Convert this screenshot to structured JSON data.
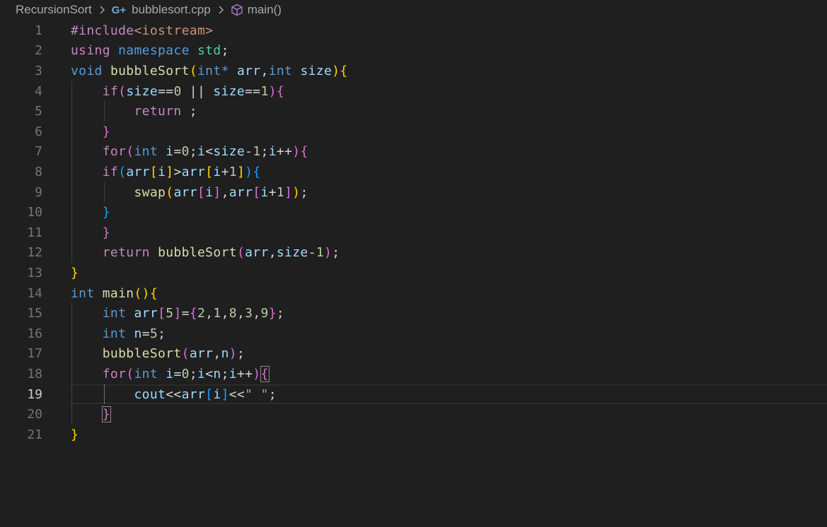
{
  "breadcrumb": {
    "folder": "RecursionSort",
    "file": "bubblesort.cpp",
    "file_icon": "C++ file icon",
    "symbol": "main()",
    "symbol_icon": "cube-icon"
  },
  "editor": {
    "current_line": 19,
    "lines": [
      {
        "n": "1",
        "tokens": [
          [
            "#include",
            "kw-c"
          ],
          [
            "<iostream>",
            "str"
          ]
        ]
      },
      {
        "n": "2",
        "tokens": [
          [
            "using",
            "kw-c"
          ],
          [
            " ",
            "p"
          ],
          [
            "namespace",
            "kw-b"
          ],
          [
            " ",
            "p"
          ],
          [
            "std",
            "ns"
          ],
          [
            ";",
            "p"
          ]
        ]
      },
      {
        "n": "3",
        "tokens": [
          [
            "void",
            "kw-b"
          ],
          [
            " ",
            "p"
          ],
          [
            "bubbleSort",
            "fn"
          ],
          [
            "(",
            "b1"
          ],
          [
            "int",
            "kw-b"
          ],
          [
            "*",
            "kw-b"
          ],
          [
            " ",
            "p"
          ],
          [
            "arr",
            "var"
          ],
          [
            ",",
            "p"
          ],
          [
            "int",
            "kw-b"
          ],
          [
            " ",
            "p"
          ],
          [
            "size",
            "var"
          ],
          [
            ")",
            "b1"
          ],
          [
            "{",
            "b1"
          ]
        ]
      },
      {
        "n": "4",
        "tokens": [
          [
            "    ",
            "p"
          ],
          [
            "if",
            "kw-c"
          ],
          [
            "(",
            "b2"
          ],
          [
            "size",
            "var"
          ],
          [
            "==",
            "p"
          ],
          [
            "0",
            "num"
          ],
          [
            " || ",
            "p"
          ],
          [
            "size",
            "var"
          ],
          [
            "==",
            "p"
          ],
          [
            "1",
            "num"
          ],
          [
            ")",
            "b2"
          ],
          [
            "{",
            "b2"
          ]
        ]
      },
      {
        "n": "5",
        "tokens": [
          [
            "        ",
            "p"
          ],
          [
            "return",
            "kw-c"
          ],
          [
            " ;",
            "p"
          ]
        ]
      },
      {
        "n": "6",
        "tokens": [
          [
            "    ",
            "p"
          ],
          [
            "}",
            "b2"
          ]
        ]
      },
      {
        "n": "7",
        "tokens": [
          [
            "    ",
            "p"
          ],
          [
            "for",
            "kw-c"
          ],
          [
            "(",
            "b2"
          ],
          [
            "int",
            "kw-b"
          ],
          [
            " ",
            "p"
          ],
          [
            "i",
            "var"
          ],
          [
            "=",
            "p"
          ],
          [
            "0",
            "num"
          ],
          [
            ";",
            "p"
          ],
          [
            "i",
            "var"
          ],
          [
            "<",
            "p"
          ],
          [
            "size",
            "var"
          ],
          [
            "-",
            "p"
          ],
          [
            "1",
            "num"
          ],
          [
            ";",
            "p"
          ],
          [
            "i",
            "var"
          ],
          [
            "++",
            "p"
          ],
          [
            ")",
            "b2"
          ],
          [
            "{",
            "b2"
          ]
        ]
      },
      {
        "n": "8",
        "tokens": [
          [
            "    ",
            "p"
          ],
          [
            "if",
            "kw-c"
          ],
          [
            "(",
            "b3"
          ],
          [
            "arr",
            "var"
          ],
          [
            "[",
            "b1"
          ],
          [
            "i",
            "var"
          ],
          [
            "]",
            "b1"
          ],
          [
            ">",
            "p"
          ],
          [
            "arr",
            "var"
          ],
          [
            "[",
            "b1"
          ],
          [
            "i",
            "var"
          ],
          [
            "+",
            "p"
          ],
          [
            "1",
            "num"
          ],
          [
            "]",
            "b1"
          ],
          [
            ")",
            "b3"
          ],
          [
            "{",
            "b3"
          ]
        ]
      },
      {
        "n": "9",
        "tokens": [
          [
            "        ",
            "p"
          ],
          [
            "swap",
            "fn"
          ],
          [
            "(",
            "b1"
          ],
          [
            "arr",
            "var"
          ],
          [
            "[",
            "b2"
          ],
          [
            "i",
            "var"
          ],
          [
            "]",
            "b2"
          ],
          [
            ",",
            "p"
          ],
          [
            "arr",
            "var"
          ],
          [
            "[",
            "b2"
          ],
          [
            "i",
            "var"
          ],
          [
            "+",
            "p"
          ],
          [
            "1",
            "num"
          ],
          [
            "]",
            "b2"
          ],
          [
            ")",
            "b1"
          ],
          [
            ";",
            "p"
          ]
        ]
      },
      {
        "n": "10",
        "tokens": [
          [
            "    ",
            "p"
          ],
          [
            "}",
            "b3"
          ]
        ]
      },
      {
        "n": "11",
        "tokens": [
          [
            "    ",
            "p"
          ],
          [
            "}",
            "b2"
          ]
        ]
      },
      {
        "n": "12",
        "tokens": [
          [
            "    ",
            "p"
          ],
          [
            "return",
            "kw-c"
          ],
          [
            " ",
            "p"
          ],
          [
            "bubbleSort",
            "fn"
          ],
          [
            "(",
            "b2"
          ],
          [
            "arr",
            "var"
          ],
          [
            ",",
            "p"
          ],
          [
            "size",
            "var"
          ],
          [
            "-",
            "p"
          ],
          [
            "1",
            "num"
          ],
          [
            ")",
            "b2"
          ],
          [
            ";",
            "p"
          ]
        ]
      },
      {
        "n": "13",
        "tokens": [
          [
            "}",
            "b1"
          ]
        ]
      },
      {
        "n": "14",
        "tokens": [
          [
            "int",
            "kw-b"
          ],
          [
            " ",
            "p"
          ],
          [
            "main",
            "fn"
          ],
          [
            "()",
            "b1"
          ],
          [
            "{",
            "b1"
          ]
        ]
      },
      {
        "n": "15",
        "tokens": [
          [
            "    ",
            "p"
          ],
          [
            "int",
            "kw-b"
          ],
          [
            " ",
            "p"
          ],
          [
            "arr",
            "var"
          ],
          [
            "[",
            "b2"
          ],
          [
            "5",
            "num"
          ],
          [
            "]",
            "b2"
          ],
          [
            "=",
            "p"
          ],
          [
            "{",
            "b2"
          ],
          [
            "2",
            "num"
          ],
          [
            ",",
            "p"
          ],
          [
            "1",
            "num"
          ],
          [
            ",",
            "p"
          ],
          [
            "8",
            "num"
          ],
          [
            ",",
            "p"
          ],
          [
            "3",
            "num"
          ],
          [
            ",",
            "p"
          ],
          [
            "9",
            "num"
          ],
          [
            "}",
            "b2"
          ],
          [
            ";",
            "p"
          ]
        ]
      },
      {
        "n": "16",
        "tokens": [
          [
            "    ",
            "p"
          ],
          [
            "int",
            "kw-b"
          ],
          [
            " ",
            "p"
          ],
          [
            "n",
            "var"
          ],
          [
            "=",
            "p"
          ],
          [
            "5",
            "num"
          ],
          [
            ";",
            "p"
          ]
        ]
      },
      {
        "n": "17",
        "tokens": [
          [
            "    ",
            "p"
          ],
          [
            "bubbleSort",
            "fn"
          ],
          [
            "(",
            "b2"
          ],
          [
            "arr",
            "var"
          ],
          [
            ",",
            "p"
          ],
          [
            "n",
            "var"
          ],
          [
            ")",
            "b2"
          ],
          [
            ";",
            "p"
          ]
        ]
      },
      {
        "n": "18",
        "tokens": [
          [
            "    ",
            "p"
          ],
          [
            "for",
            "kw-c"
          ],
          [
            "(",
            "b2"
          ],
          [
            "int",
            "kw-b"
          ],
          [
            " ",
            "p"
          ],
          [
            "i",
            "var"
          ],
          [
            "=",
            "p"
          ],
          [
            "0",
            "num"
          ],
          [
            ";",
            "p"
          ],
          [
            "i",
            "var"
          ],
          [
            "<",
            "p"
          ],
          [
            "n",
            "var"
          ],
          [
            ";",
            "p"
          ],
          [
            "i",
            "var"
          ],
          [
            "++",
            "p"
          ],
          [
            ")",
            "b2"
          ],
          [
            "{",
            "b2 bracket-box"
          ]
        ]
      },
      {
        "n": "19",
        "tokens": [
          [
            "        ",
            "p"
          ],
          [
            "cout",
            "var"
          ],
          [
            "<<",
            "p"
          ],
          [
            "arr",
            "var"
          ],
          [
            "[",
            "b3"
          ],
          [
            "i",
            "var"
          ],
          [
            "]",
            "b3"
          ],
          [
            "<<",
            "p"
          ],
          [
            "\" \"",
            "str"
          ],
          [
            ";",
            "p"
          ]
        ]
      },
      {
        "n": "20",
        "tokens": [
          [
            "    ",
            "p"
          ],
          [
            "}",
            "b2 bracket-box"
          ]
        ]
      },
      {
        "n": "21",
        "tokens": [
          [
            "}",
            "b1"
          ]
        ]
      }
    ]
  }
}
